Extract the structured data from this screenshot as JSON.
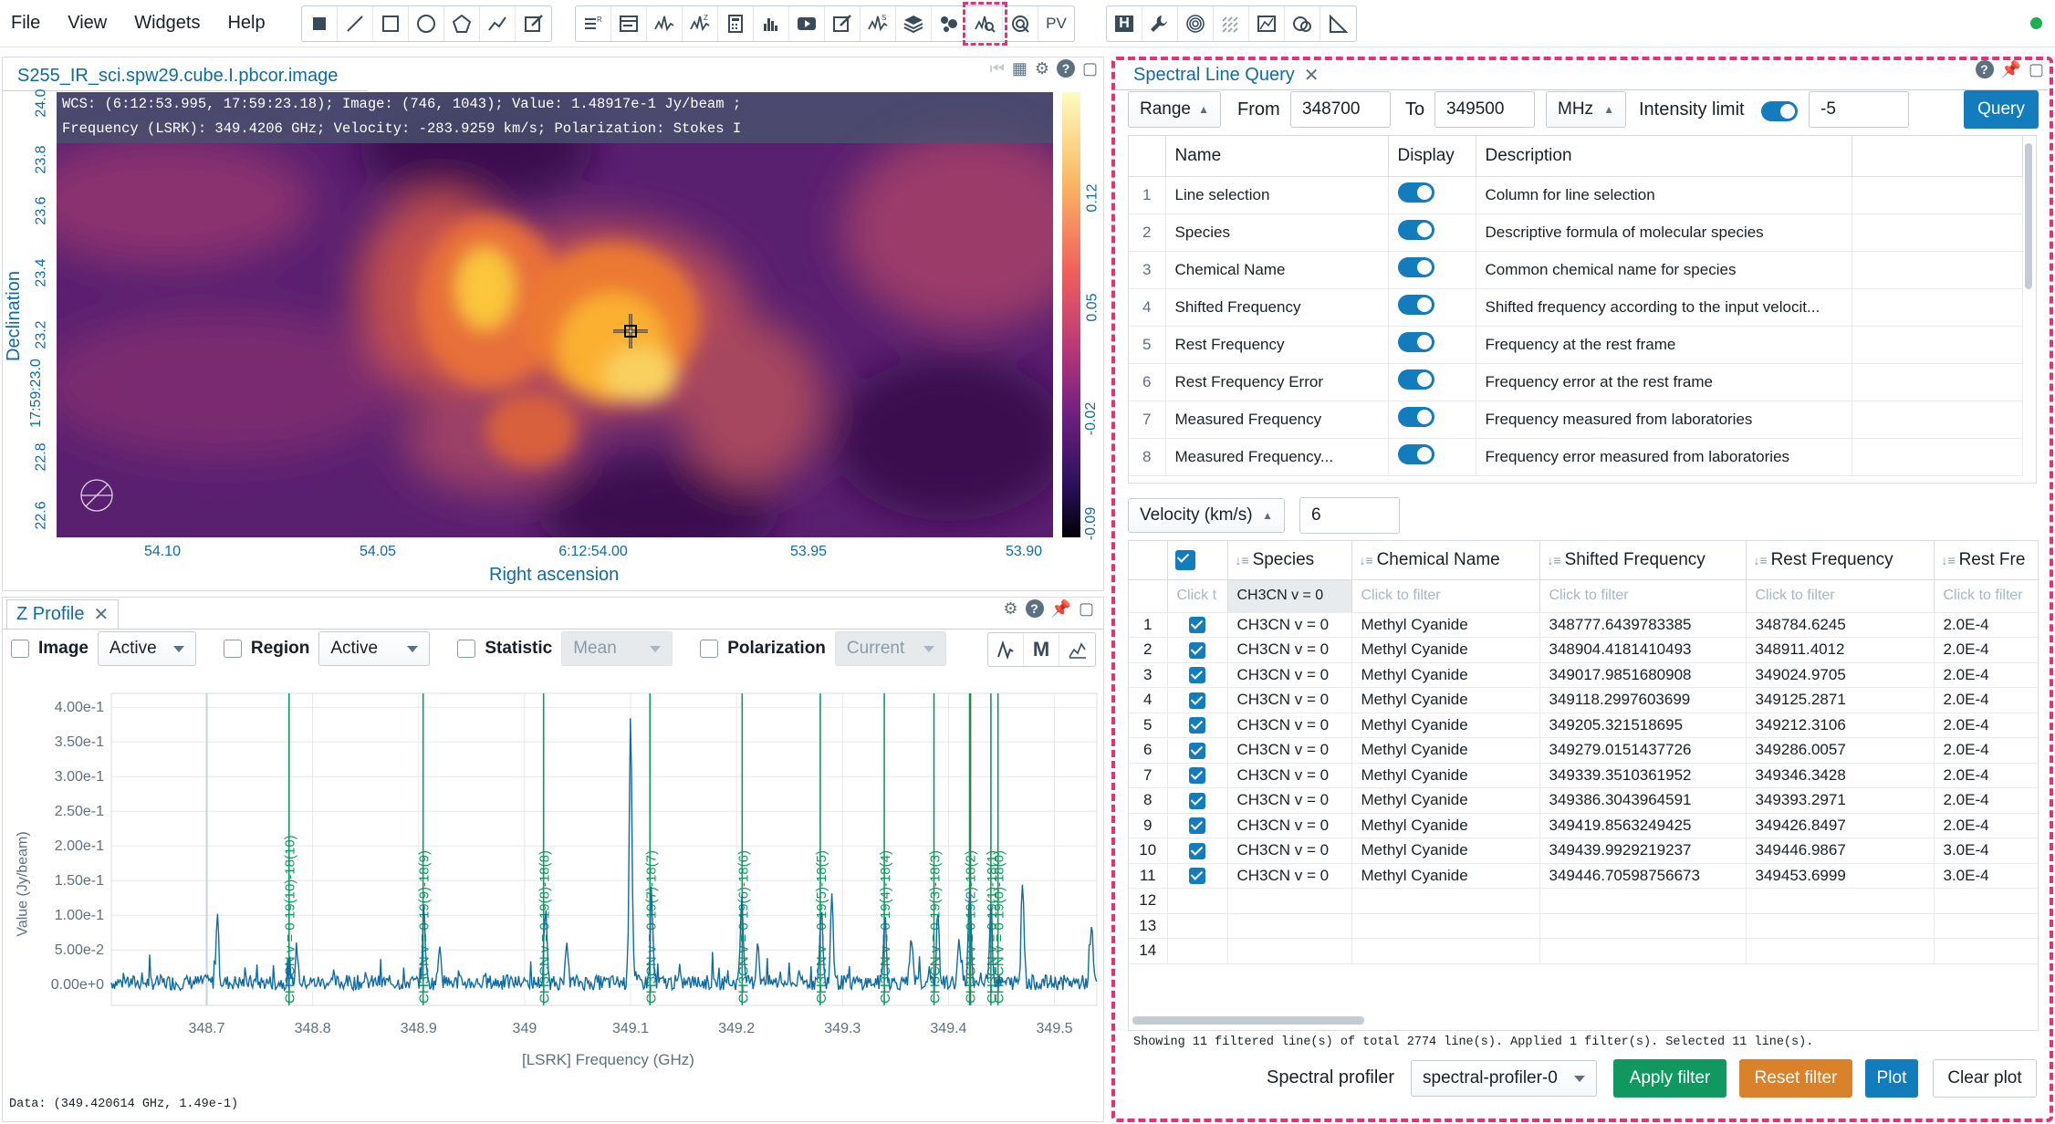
{
  "menu": [
    "File",
    "View",
    "Widgets",
    "Help"
  ],
  "toolbar_groups": [
    [
      "square-icon",
      "line-icon",
      "rectangle-icon",
      "ellipse-icon",
      "polygon-icon",
      "polyline-icon",
      "annotation-edit-icon"
    ],
    [
      "render-config-icon",
      "header-icon",
      "xy-profile-icon",
      "z-profile-icon",
      "calculator-icon",
      "histogram-icon",
      "animator-icon",
      "edit-icon",
      "spectral-profile-icon",
      "layers-icon",
      "catalog-icon",
      "spectral-line-query-icon",
      "vector-overlay-icon",
      "pv-generator-icon"
    ],
    [
      "hdf-icon",
      "wrench-icon",
      "contour-icon",
      "vector-field-icon",
      "stokes-icon",
      "image-fitting-icon",
      "ruler-icon"
    ]
  ],
  "toolbar_text": {
    "pv": "PV",
    "h": "H"
  },
  "image": {
    "tab_title": "S255_IR_sci.spw29.cube.I.pbcor.image",
    "cursor_line1": "WCS: (6:12:53.995, 17:59:23.18); Image: (746, 1043); Value:  1.48917e-1 Jy/beam ;",
    "cursor_line2": "Frequency (LSRK): 349.4206 GHz; Velocity: -283.9259 km/s; Polarization: Stokes I",
    "y_ticks": [
      "24.0",
      "23.8",
      "23.6",
      "23.4",
      "23.2",
      "17:59:23.0",
      "22.8",
      "22.6"
    ],
    "x_ticks": [
      "54.10",
      "54.05",
      "6:12:54.00",
      "53.95",
      "53.90"
    ],
    "colorbar_ticks": [
      "0.12",
      "0.05",
      "-0.02",
      "-0.09"
    ],
    "xlabel": "Right ascension",
    "ylabel": "Declination"
  },
  "zprofile": {
    "tab_title": "Z Profile",
    "image_label": "Image",
    "image_value": "Active",
    "region_label": "Region",
    "region_value": "Active",
    "statistic_label": "Statistic",
    "statistic_value": "Mean",
    "polarization_label": "Polarization",
    "polarization_value": "Current",
    "m_button": "M",
    "cursor_data": "Data: (349.420614 GHz, 1.49e-1)"
  },
  "chart_data": {
    "type": "line",
    "xlabel": "[LSRK] Frequency (GHz)",
    "ylabel": "Value (Jy/beam)",
    "xlim": [
      348.61,
      349.54
    ],
    "ylim": [
      -0.03,
      0.42
    ],
    "x_ticks": [
      348.7,
      348.8,
      348.9,
      349.0,
      349.1,
      349.2,
      349.3,
      349.4,
      349.5
    ],
    "x_tick_labels": [
      "348.7",
      "348.8",
      "348.9",
      "349",
      "349.1",
      "349.2",
      "349.3",
      "349.4",
      "349.5"
    ],
    "y_ticks": [
      0,
      0.05,
      0.1,
      0.15,
      0.2,
      0.25,
      0.3,
      0.35,
      0.4
    ],
    "y_tick_labels": [
      "0.00e+0",
      "5.00e-2",
      "1.00e-1",
      "1.50e-1",
      "2.00e-1",
      "2.50e-1",
      "3.00e-1",
      "3.50e-1",
      "4.00e-1"
    ],
    "peaks": [
      [
        348.71,
        0.1
      ],
      [
        348.785,
        0.05
      ],
      [
        348.905,
        0.11
      ],
      [
        348.92,
        0.06
      ],
      [
        349.02,
        0.1
      ],
      [
        349.04,
        0.05
      ],
      [
        349.1,
        0.39
      ],
      [
        349.12,
        0.12
      ],
      [
        349.205,
        0.13
      ],
      [
        349.22,
        0.06
      ],
      [
        349.28,
        0.11
      ],
      [
        349.29,
        0.13
      ],
      [
        349.34,
        0.1
      ],
      [
        349.365,
        0.06
      ],
      [
        349.39,
        0.1
      ],
      [
        349.41,
        0.06
      ],
      [
        349.42,
        0.14
      ],
      [
        349.44,
        0.12
      ],
      [
        349.47,
        0.15
      ],
      [
        349.535,
        0.08
      ]
    ],
    "line_markers": [
      {
        "x": 348.7777,
        "label": "CH3CN v = 0  19(10)-18(10)"
      },
      {
        "x": 348.9042,
        "label": "CH3CN v = 0  19(9)-18(9)"
      },
      {
        "x": 349.0179,
        "label": "CH3CN v = 0  19(8)-18(8)"
      },
      {
        "x": 349.1183,
        "label": "CH3CN v = 0  19(7)-18(7)"
      },
      {
        "x": 349.2053,
        "label": "CH3CN v = 0  19(6)-18(6)"
      },
      {
        "x": 349.279,
        "label": "CH3CN v = 0  19(5)-18(5)"
      },
      {
        "x": 349.3394,
        "label": "CH3CN v = 0  19(4)-18(4)"
      },
      {
        "x": 349.3863,
        "label": "CH3CN v = 0  19(3)-18(3)"
      },
      {
        "x": 349.4199,
        "label": "CH3CN v = 0  19(2)-18(2)"
      },
      {
        "x": 349.44,
        "label": "CH3CN v = 0  19(1)-18(1)"
      },
      {
        "x": 349.4467,
        "label": "CH3CN v = 0  19(0)-18(0)"
      }
    ],
    "line_color": "#106ba3",
    "marker_color": "#0f9960"
  },
  "query": {
    "tab_title": "Spectral Line Query",
    "range_mode": "Range",
    "from_label": "From",
    "from_value": "348700",
    "to_label": "To",
    "to_value": "349500",
    "unit": "MHz",
    "intensity_label": "Intensity limit",
    "intensity_value": "-5",
    "query_button": "Query",
    "velocity_label": "Velocity (km/s)",
    "velocity_value": "6",
    "column_headers": [
      "Name",
      "Display",
      "Description"
    ],
    "columns": [
      {
        "n": "1",
        "name": "Line selection",
        "desc": "Column for line selection"
      },
      {
        "n": "2",
        "name": "Species",
        "desc": "Descriptive formula of molecular species"
      },
      {
        "n": "3",
        "name": "Chemical Name",
        "desc": "Common chemical name for species"
      },
      {
        "n": "4",
        "name": "Shifted Frequency",
        "desc": "Shifted frequency according to the input velocit..."
      },
      {
        "n": "5",
        "name": "Rest Frequency",
        "desc": "Frequency at the rest frame"
      },
      {
        "n": "6",
        "name": "Rest Frequency Error",
        "desc": "Frequency error at the rest frame"
      },
      {
        "n": "7",
        "name": "Measured Frequency",
        "desc": "Frequency measured from laboratories"
      },
      {
        "n": "8",
        "name": "Measured Frequency...",
        "desc": "Frequency error measured from laboratories"
      }
    ],
    "result_headers": [
      "Species",
      "Chemical Name",
      "Shifted Frequency",
      "Rest Frequency",
      "Rest Fre"
    ],
    "filter_placeholder": "Click to filter",
    "filter_placeholder_short": "Click t",
    "species_filter": "CH3CN v = 0",
    "rows": [
      {
        "n": "1",
        "sp": "CH3CN v = 0",
        "cn": "Methyl Cyanide",
        "sf": "348777.6439783385",
        "rf": "348784.6245",
        "re": "2.0E-4"
      },
      {
        "n": "2",
        "sp": "CH3CN v = 0",
        "cn": "Methyl Cyanide",
        "sf": "348904.4181410493",
        "rf": "348911.4012",
        "re": "2.0E-4"
      },
      {
        "n": "3",
        "sp": "CH3CN v = 0",
        "cn": "Methyl Cyanide",
        "sf": "349017.9851680908",
        "rf": "349024.9705",
        "re": "2.0E-4"
      },
      {
        "n": "4",
        "sp": "CH3CN v = 0",
        "cn": "Methyl Cyanide",
        "sf": "349118.2997603699",
        "rf": "349125.2871",
        "re": "2.0E-4"
      },
      {
        "n": "5",
        "sp": "CH3CN v = 0",
        "cn": "Methyl Cyanide",
        "sf": "349205.321518695",
        "rf": "349212.3106",
        "re": "2.0E-4"
      },
      {
        "n": "6",
        "sp": "CH3CN v = 0",
        "cn": "Methyl Cyanide",
        "sf": "349279.0151437726",
        "rf": "349286.0057",
        "re": "2.0E-4"
      },
      {
        "n": "7",
        "sp": "CH3CN v = 0",
        "cn": "Methyl Cyanide",
        "sf": "349339.3510361952",
        "rf": "349346.3428",
        "re": "2.0E-4"
      },
      {
        "n": "8",
        "sp": "CH3CN v = 0",
        "cn": "Methyl Cyanide",
        "sf": "349386.3043964591",
        "rf": "349393.2971",
        "re": "2.0E-4"
      },
      {
        "n": "9",
        "sp": "CH3CN v = 0",
        "cn": "Methyl Cyanide",
        "sf": "349419.8563249425",
        "rf": "349426.8497",
        "re": "2.0E-4"
      },
      {
        "n": "10",
        "sp": "CH3CN v = 0",
        "cn": "Methyl Cyanide",
        "sf": "349439.9929219237",
        "rf": "349446.9867",
        "re": "3.0E-4"
      },
      {
        "n": "11",
        "sp": "CH3CN v = 0",
        "cn": "Methyl Cyanide",
        "sf": "349446.70598756673",
        "rf": "349453.6999",
        "re": "3.0E-4"
      }
    ],
    "empty_rows": [
      "12",
      "13",
      "14"
    ],
    "status": "Showing 11 filtered line(s) of total 2774 line(s). Applied 1 filter(s). Selected 11 line(s).",
    "profiler_label": "Spectral profiler",
    "profiler_value": "spectral-profiler-0",
    "apply_filter": "Apply filter",
    "reset_filter": "Reset filter",
    "plot": "Plot",
    "clear_plot": "Clear plot"
  },
  "colors": {
    "accent": "#137cbd",
    "green": "#0f9960",
    "orange": "#d9822b",
    "highlight": "#e2337a"
  }
}
